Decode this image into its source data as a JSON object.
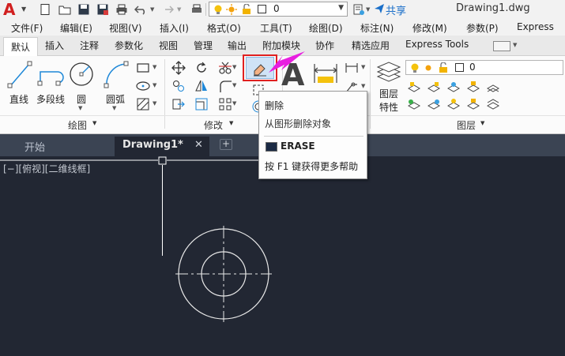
{
  "qat": {
    "layer_value": "0",
    "share_label": "共享",
    "doc_title": "Drawing1.dwg"
  },
  "menubar": {
    "items": [
      "文件(F)",
      "编辑(E)",
      "视图(V)",
      "插入(I)",
      "格式(O)",
      "工具(T)",
      "绘图(D)",
      "标注(N)",
      "修改(M)",
      "参数(P)",
      "Express"
    ]
  },
  "ribbon_tabs": {
    "items": [
      "默认",
      "插入",
      "注释",
      "参数化",
      "视图",
      "管理",
      "输出",
      "附加模块",
      "协作",
      "精选应用",
      "Express Tools"
    ],
    "active": "默认"
  },
  "ribbon": {
    "draw_tools": [
      "直线",
      "多段线",
      "圆",
      "圆弧"
    ],
    "draw_panel_label": "绘图",
    "modify_panel_label": "修改",
    "layer_props_label_line1": "图层",
    "layer_props_label_line2": "特性",
    "layer_value": "0",
    "layers_panel_label": "图层"
  },
  "doc_tabs": {
    "start_label": "开始",
    "current_label": "Drawing1*",
    "close_glyph": "✕",
    "add_glyph": "+"
  },
  "viewport": {
    "label": "[−][俯视][二维线框]"
  },
  "tooltip": {
    "title": "删除",
    "description": "从图形删除对象",
    "command": "ERASE",
    "help_text": "按 F1 键获得更多帮助"
  },
  "colors": {
    "canvas_bg": "#222733",
    "highlight": "#e02020",
    "arrow": "#e81ee0",
    "share_blue": "#1a6fc9"
  }
}
